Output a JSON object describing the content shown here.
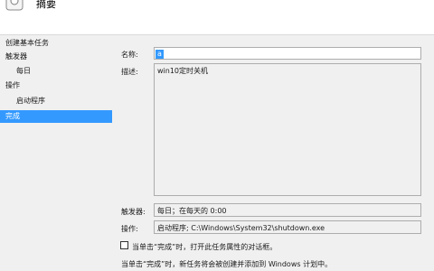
{
  "header": {
    "title": "摘要",
    "icon": "wizard-icon"
  },
  "nav": {
    "items": [
      {
        "label": "创建基本任务",
        "indent": false,
        "selected": false
      },
      {
        "label": "触发器",
        "indent": false,
        "selected": false
      },
      {
        "label": "每日",
        "indent": true,
        "selected": false
      },
      {
        "label": "操作",
        "indent": false,
        "selected": false
      },
      {
        "label": "启动程序",
        "indent": true,
        "selected": false
      },
      {
        "label": "完成",
        "indent": false,
        "selected": true
      }
    ]
  },
  "form": {
    "name_label": "名称:",
    "name_value": "a",
    "description_label": "描述:",
    "description_value": "win10定时关机",
    "trigger_label": "触发器:",
    "trigger_value": "每日；在每天的 0:00",
    "action_label": "操作:",
    "action_value": "启动程序; C:\\Windows\\System32\\shutdown.exe"
  },
  "footer": {
    "checkbox_label": "当单击“完成”时，打开此任务属性的对话框。",
    "checkbox_checked": false,
    "info_text": "当单击“完成”时，新任务将会被创建并添加到 Windows 计划中。"
  },
  "colors": {
    "selection": "#3399ff",
    "panel_background": "#f0f0f0"
  }
}
